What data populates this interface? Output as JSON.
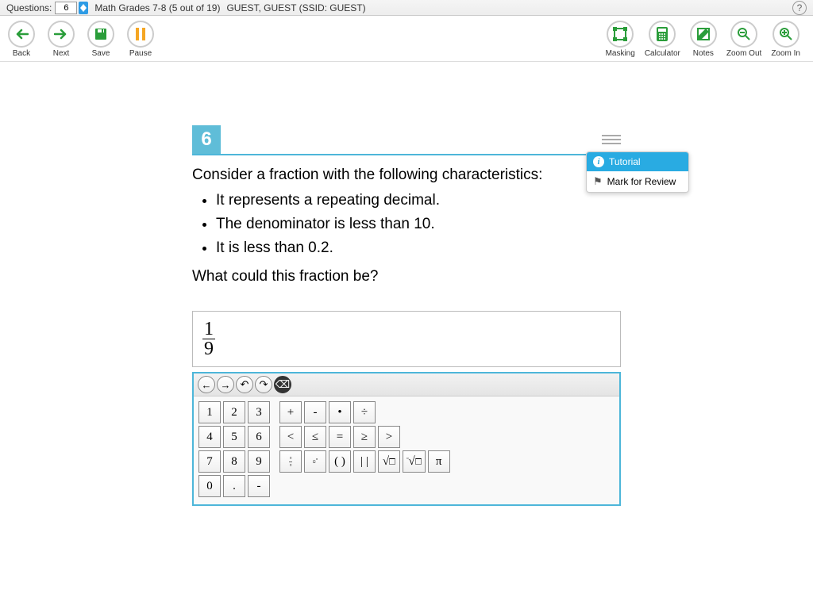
{
  "topbar": {
    "questions_label": "Questions:",
    "current_question": "6",
    "title": "Math Grades 7-8 (5 out of 19)",
    "user": "GUEST, GUEST (SSID: GUEST)",
    "help": "?"
  },
  "toolbar": {
    "back": "Back",
    "next": "Next",
    "save": "Save",
    "pause": "Pause",
    "masking": "Masking",
    "calculator": "Calculator",
    "notes": "Notes",
    "zoom_out": "Zoom Out",
    "zoom_in": "Zoom In"
  },
  "question": {
    "number": "6",
    "prompt": "Consider a fraction with the following characteristics:",
    "bullets": [
      "It represents a repeating decimal.",
      "The denominator is less than 10.",
      "It is less than 0.2."
    ],
    "ask": "What could this fraction be?"
  },
  "popup": {
    "tutorial": "Tutorial",
    "mark": "Mark for Review"
  },
  "answer": {
    "numerator": "1",
    "denominator": "9"
  },
  "keypad": {
    "row1": [
      "1",
      "2",
      "3",
      "+",
      "-",
      "•",
      "÷"
    ],
    "row2": [
      "4",
      "5",
      "6",
      "<",
      "≤",
      "=",
      "≥",
      ">"
    ],
    "row3": [
      "7",
      "8",
      "9"
    ],
    "row3_ops": [
      "frac",
      "pow",
      "()",
      "| |",
      "sqrt",
      "nroot",
      "π"
    ],
    "row4": [
      "0",
      ".",
      "-"
    ]
  }
}
